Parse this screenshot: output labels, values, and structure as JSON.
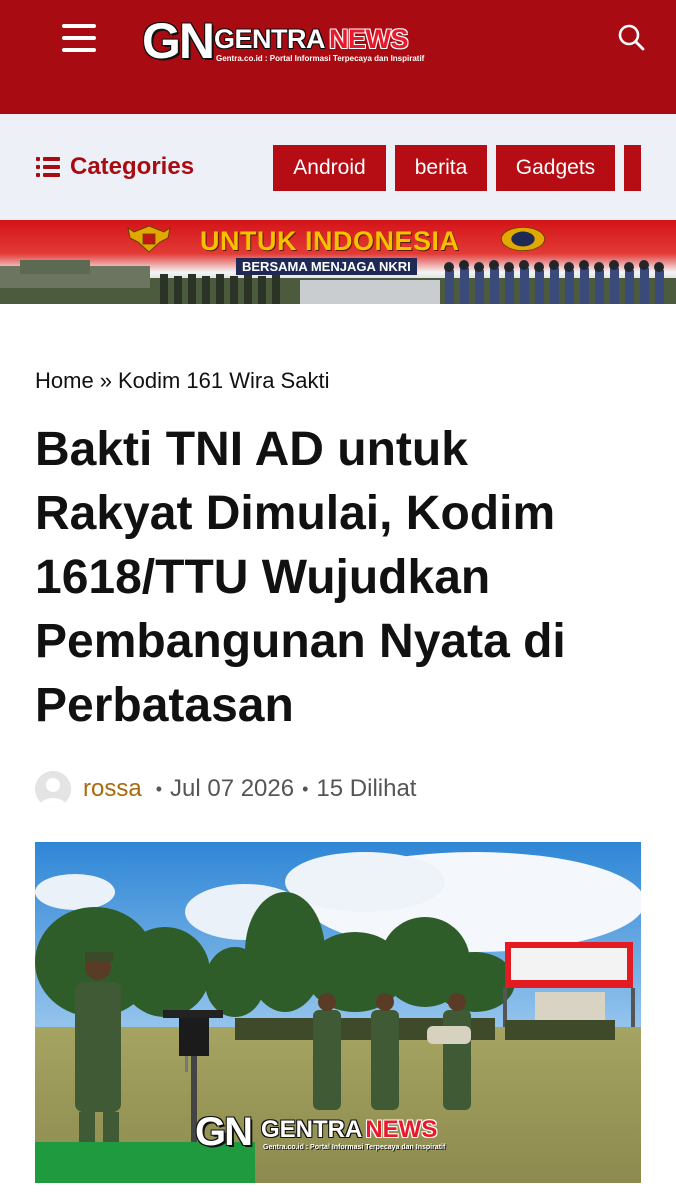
{
  "header": {
    "logo_mark": "GN",
    "logo_word1": "GENTRA",
    "logo_word2": "NEWS",
    "logo_tagline": "Gentra.co.id : Portal Informasi Terpecaya dan Inspiratif",
    "menu_icon": "hamburger-menu-icon",
    "search_icon": "search-icon",
    "bg_color": "#a80c12"
  },
  "categories": {
    "toggle_label": "Categories",
    "toggle_icon": "list-icon",
    "items": [
      "Android",
      "berita",
      "Gadgets"
    ]
  },
  "banner": {
    "title": "UNTUK INDONESIA",
    "subtitle": "BERSAMA MENJAGA NKRI"
  },
  "article": {
    "breadcrumb": {
      "home": "Home",
      "separator": "»",
      "category": "Kodim 161 Wira Sakti"
    },
    "title": "Bakti TNI AD untuk Rakyat Dimulai, Kodim 1618/TTU Wujudkan Pembangunan Nyata di Perbatasan",
    "author": "rossa",
    "date": "Jul 07 2026",
    "views": "15 Dilihat",
    "meta_separator": "•",
    "photo": {
      "watermark_mark": "GN",
      "watermark_word1": "GENTRA",
      "watermark_word2": "NEWS",
      "watermark_tagline": "Gentra.co.id : Portal Informasi Terpecaya dan Inspiratif"
    }
  },
  "colors": {
    "brand_red": "#a80c12",
    "chip_red": "#b50d13",
    "category_bar_bg": "#eef0f8",
    "author_color": "#a8690f"
  }
}
